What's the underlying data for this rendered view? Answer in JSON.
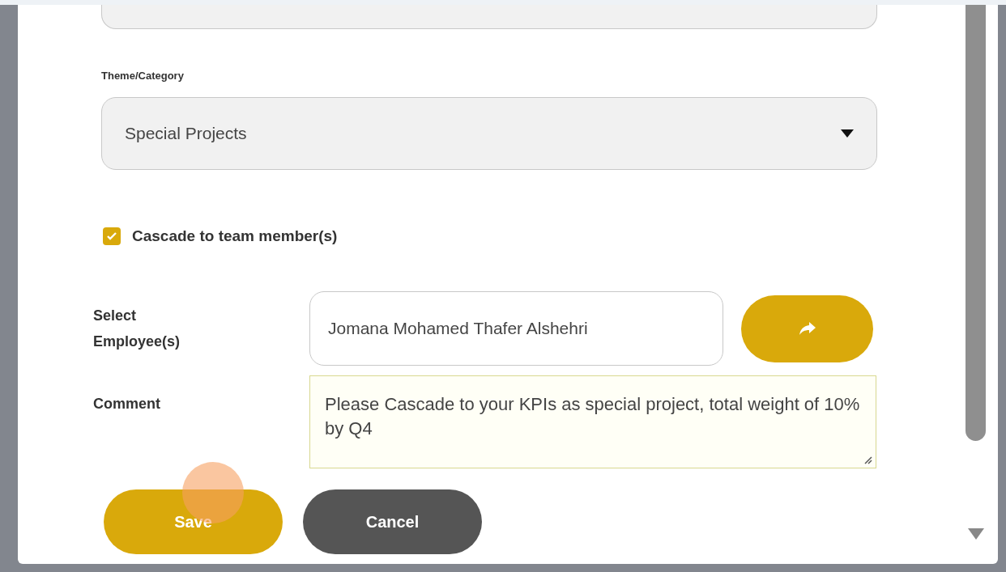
{
  "theme_category": {
    "label": "Theme/Category",
    "value": "Special Projects"
  },
  "cascade": {
    "label": "Cascade to team member(s)",
    "checked": true
  },
  "select_employees": {
    "label": "Select Employee(s)",
    "value": "Jomana Mohamed Thafer Alshehri"
  },
  "comment": {
    "label": "Comment",
    "value": "Please Cascade to your KPIs as special project, total weight of 10% by Q4"
  },
  "buttons": [
    {
      "label": "Save",
      "kind": "primary"
    },
    {
      "label": "Cancel",
      "kind": "secondary"
    }
  ]
}
